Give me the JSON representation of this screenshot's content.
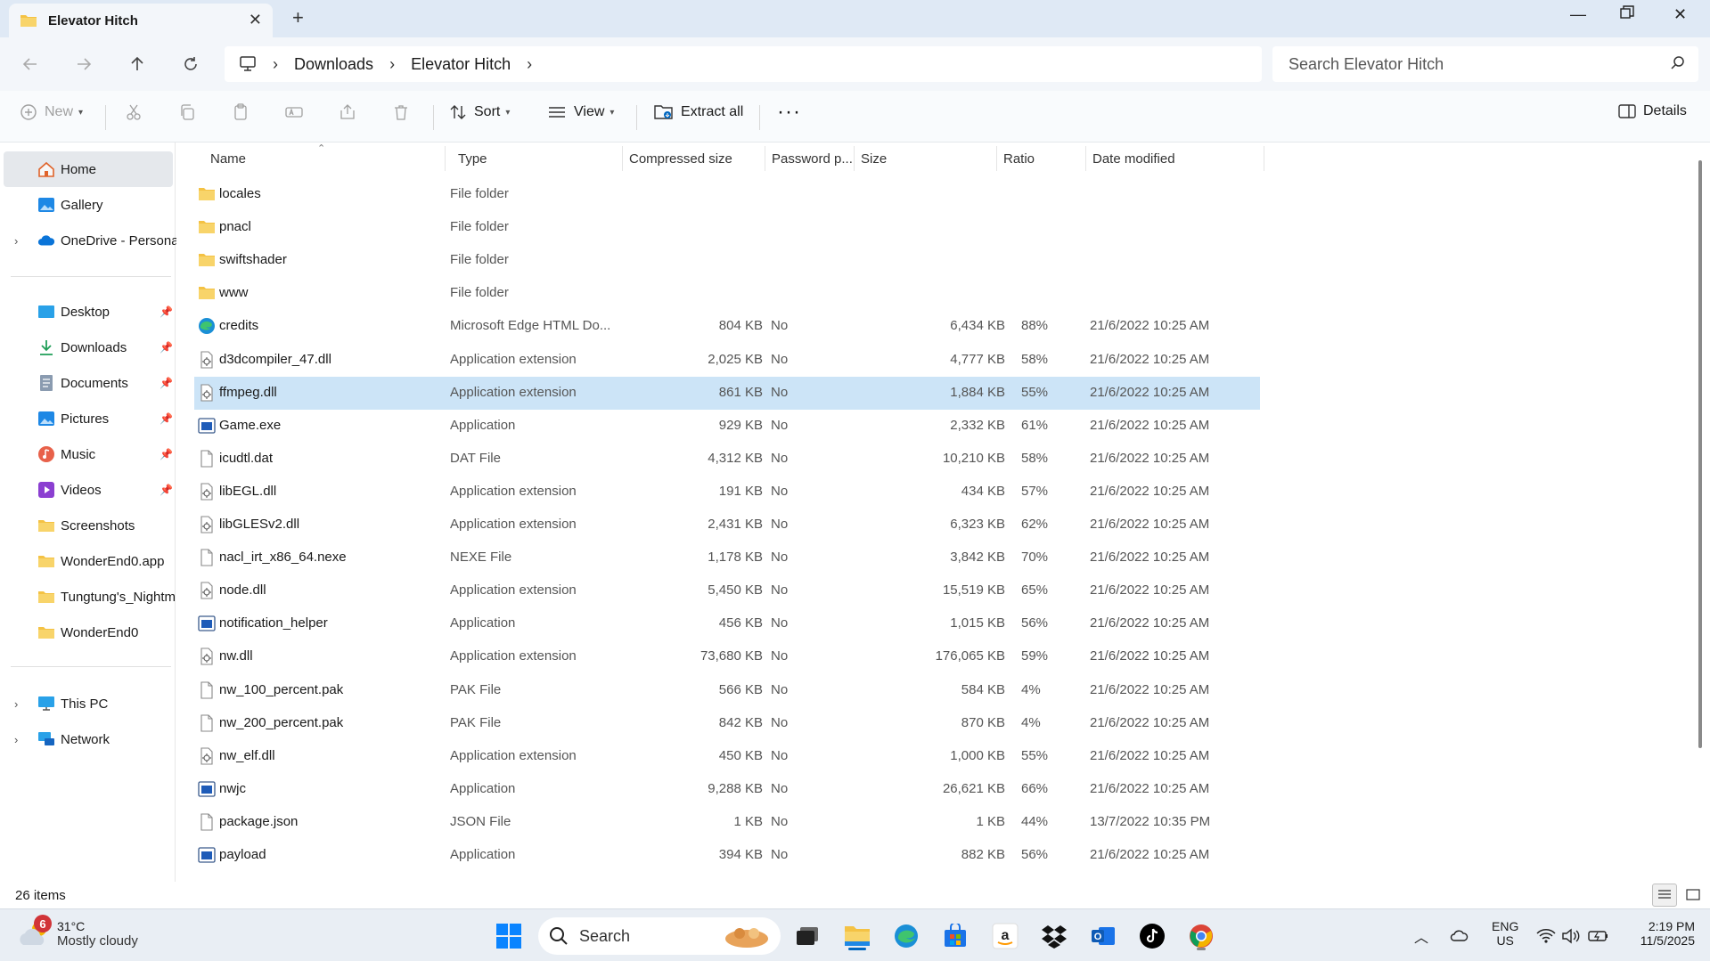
{
  "window": {
    "tab_title": "Elevator Hitch"
  },
  "address": {
    "crumbs": [
      "Downloads",
      "Elevator Hitch"
    ],
    "search_placeholder": "Search Elevator Hitch"
  },
  "commands": {
    "new": "New",
    "sort": "Sort",
    "view": "View",
    "extract_all": "Extract all",
    "details": "Details"
  },
  "sidebar": {
    "top": [
      {
        "label": "Home",
        "icon": "home-icon"
      },
      {
        "label": "Gallery",
        "icon": "gallery-icon"
      },
      {
        "label": "OneDrive - Persona",
        "icon": "onedrive-icon"
      }
    ],
    "quick": [
      {
        "label": "Desktop",
        "icon": "desktop-icon",
        "pinned": true
      },
      {
        "label": "Downloads",
        "icon": "downloads-icon",
        "pinned": true
      },
      {
        "label": "Documents",
        "icon": "documents-icon",
        "pinned": true
      },
      {
        "label": "Pictures",
        "icon": "pictures-icon",
        "pinned": true
      },
      {
        "label": "Music",
        "icon": "music-icon",
        "pinned": true
      },
      {
        "label": "Videos",
        "icon": "videos-icon",
        "pinned": true
      },
      {
        "label": "Screenshots",
        "icon": "folder-icon",
        "pinned": false
      },
      {
        "label": "WonderEnd0.app",
        "icon": "folder-icon",
        "pinned": false
      },
      {
        "label": "Tungtung's_Nightm",
        "icon": "folder-icon",
        "pinned": false
      },
      {
        "label": "WonderEnd0",
        "icon": "folder-icon",
        "pinned": false
      }
    ],
    "bottom": [
      {
        "label": "This PC",
        "icon": "this-pc-icon"
      },
      {
        "label": "Network",
        "icon": "network-icon"
      }
    ]
  },
  "columns": [
    "Name",
    "Type",
    "Compressed size",
    "Password p...",
    "Size",
    "Ratio",
    "Date modified"
  ],
  "files": [
    {
      "name": "locales",
      "type": "File folder",
      "compressed": "",
      "password": "",
      "size": "",
      "ratio": "",
      "date": "",
      "icon": "folder-icon"
    },
    {
      "name": "pnacl",
      "type": "File folder",
      "compressed": "",
      "password": "",
      "size": "",
      "ratio": "",
      "date": "",
      "icon": "folder-icon"
    },
    {
      "name": "swiftshader",
      "type": "File folder",
      "compressed": "",
      "password": "",
      "size": "",
      "ratio": "",
      "date": "",
      "icon": "folder-icon"
    },
    {
      "name": "www",
      "type": "File folder",
      "compressed": "",
      "password": "",
      "size": "",
      "ratio": "",
      "date": "",
      "icon": "folder-icon"
    },
    {
      "name": "credits",
      "type": "Microsoft Edge HTML Do...",
      "compressed": "804 KB",
      "password": "No",
      "size": "6,434 KB",
      "ratio": "88%",
      "date": "21/6/2022 10:25 AM",
      "icon": "edge-icon"
    },
    {
      "name": "d3dcompiler_47.dll",
      "type": "Application extension",
      "compressed": "2,025 KB",
      "password": "No",
      "size": "4,777 KB",
      "ratio": "58%",
      "date": "21/6/2022 10:25 AM",
      "icon": "dll-icon"
    },
    {
      "name": "ffmpeg.dll",
      "type": "Application extension",
      "compressed": "861 KB",
      "password": "No",
      "size": "1,884 KB",
      "ratio": "55%",
      "date": "21/6/2022 10:25 AM",
      "icon": "dll-icon"
    },
    {
      "name": "Game.exe",
      "type": "Application",
      "compressed": "929 KB",
      "password": "No",
      "size": "2,332 KB",
      "ratio": "61%",
      "date": "21/6/2022 10:25 AM",
      "icon": "app-icon"
    },
    {
      "name": "icudtl.dat",
      "type": "DAT File",
      "compressed": "4,312 KB",
      "password": "No",
      "size": "10,210 KB",
      "ratio": "58%",
      "date": "21/6/2022 10:25 AM",
      "icon": "file-icon"
    },
    {
      "name": "libEGL.dll",
      "type": "Application extension",
      "compressed": "191 KB",
      "password": "No",
      "size": "434 KB",
      "ratio": "57%",
      "date": "21/6/2022 10:25 AM",
      "icon": "dll-icon"
    },
    {
      "name": "libGLESv2.dll",
      "type": "Application extension",
      "compressed": "2,431 KB",
      "password": "No",
      "size": "6,323 KB",
      "ratio": "62%",
      "date": "21/6/2022 10:25 AM",
      "icon": "dll-icon"
    },
    {
      "name": "nacl_irt_x86_64.nexe",
      "type": "NEXE File",
      "compressed": "1,178 KB",
      "password": "No",
      "size": "3,842 KB",
      "ratio": "70%",
      "date": "21/6/2022 10:25 AM",
      "icon": "file-icon"
    },
    {
      "name": "node.dll",
      "type": "Application extension",
      "compressed": "5,450 KB",
      "password": "No",
      "size": "15,519 KB",
      "ratio": "65%",
      "date": "21/6/2022 10:25 AM",
      "icon": "dll-icon"
    },
    {
      "name": "notification_helper",
      "type": "Application",
      "compressed": "456 KB",
      "password": "No",
      "size": "1,015 KB",
      "ratio": "56%",
      "date": "21/6/2022 10:25 AM",
      "icon": "app-icon"
    },
    {
      "name": "nw.dll",
      "type": "Application extension",
      "compressed": "73,680 KB",
      "password": "No",
      "size": "176,065 KB",
      "ratio": "59%",
      "date": "21/6/2022 10:25 AM",
      "icon": "dll-icon"
    },
    {
      "name": "nw_100_percent.pak",
      "type": "PAK File",
      "compressed": "566 KB",
      "password": "No",
      "size": "584 KB",
      "ratio": "4%",
      "date": "21/6/2022 10:25 AM",
      "icon": "file-icon"
    },
    {
      "name": "nw_200_percent.pak",
      "type": "PAK File",
      "compressed": "842 KB",
      "password": "No",
      "size": "870 KB",
      "ratio": "4%",
      "date": "21/6/2022 10:25 AM",
      "icon": "file-icon"
    },
    {
      "name": "nw_elf.dll",
      "type": "Application extension",
      "compressed": "450 KB",
      "password": "No",
      "size": "1,000 KB",
      "ratio": "55%",
      "date": "21/6/2022 10:25 AM",
      "icon": "dll-icon"
    },
    {
      "name": "nwjc",
      "type": "Application",
      "compressed": "9,288 KB",
      "password": "No",
      "size": "26,621 KB",
      "ratio": "66%",
      "date": "21/6/2022 10:25 AM",
      "icon": "app-icon"
    },
    {
      "name": "package.json",
      "type": "JSON File",
      "compressed": "1 KB",
      "password": "No",
      "size": "1 KB",
      "ratio": "44%",
      "date": "13/7/2022 10:35 PM",
      "icon": "file-icon"
    },
    {
      "name": "payload",
      "type": "Application",
      "compressed": "394 KB",
      "password": "No",
      "size": "882 KB",
      "ratio": "56%",
      "date": "21/6/2022 10:25 AM",
      "icon": "app-icon"
    }
  ],
  "selected_file": "ffmpeg.dll",
  "status": {
    "item_count": "26 items"
  },
  "taskbar": {
    "weather_badge": "6",
    "temperature": "31°C",
    "condition": "Mostly cloudy",
    "search_label": "Search",
    "lang_top": "ENG",
    "lang_bottom": "US",
    "time": "2:19 PM",
    "date": "11/5/2025"
  },
  "colors": {
    "accent": "#0067c0",
    "selected_row": "#cce4f7",
    "folder": "#f4c244"
  }
}
